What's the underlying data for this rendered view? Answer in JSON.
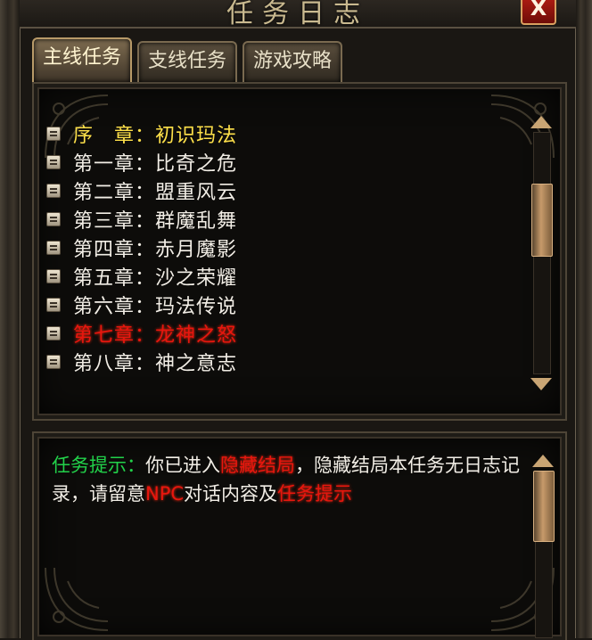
{
  "window": {
    "title": "任务日志",
    "close_label": "X"
  },
  "tabs": [
    {
      "label": "主线任务",
      "active": true
    },
    {
      "label": "支线任务",
      "active": false
    },
    {
      "label": "游戏攻略",
      "active": false
    }
  ],
  "chapters": [
    {
      "label": "序　章：初识玛法",
      "state": "current"
    },
    {
      "label": "第一章：比奇之危",
      "state": "normal"
    },
    {
      "label": "第二章：盟重风云",
      "state": "normal"
    },
    {
      "label": "第三章：群魔乱舞",
      "state": "normal"
    },
    {
      "label": "第四章：赤月魔影",
      "state": "normal"
    },
    {
      "label": "第五章：沙之荣耀",
      "state": "normal"
    },
    {
      "label": "第六章：玛法传说",
      "state": "normal"
    },
    {
      "label": "第七章：龙神之怒",
      "state": "hidden"
    },
    {
      "label": "第八章：神之意志",
      "state": "normal"
    }
  ],
  "hint": {
    "label": "任务提示：",
    "t1": "你已进入",
    "h1": "隐藏结局",
    "t2": "，隐藏结局本任务无日志记录，请留意",
    "h2": "NPC",
    "t3": "对话内容及",
    "h3": "任务提示"
  },
  "colors": {
    "current_chapter": "#ffe14a",
    "hidden_chapter": "#e8160e",
    "hint_label": "#22d14a",
    "normal_text": "#f2eee6"
  },
  "scroll": {
    "list_position_fraction": 0.3,
    "hint_position_fraction": 0.0
  }
}
